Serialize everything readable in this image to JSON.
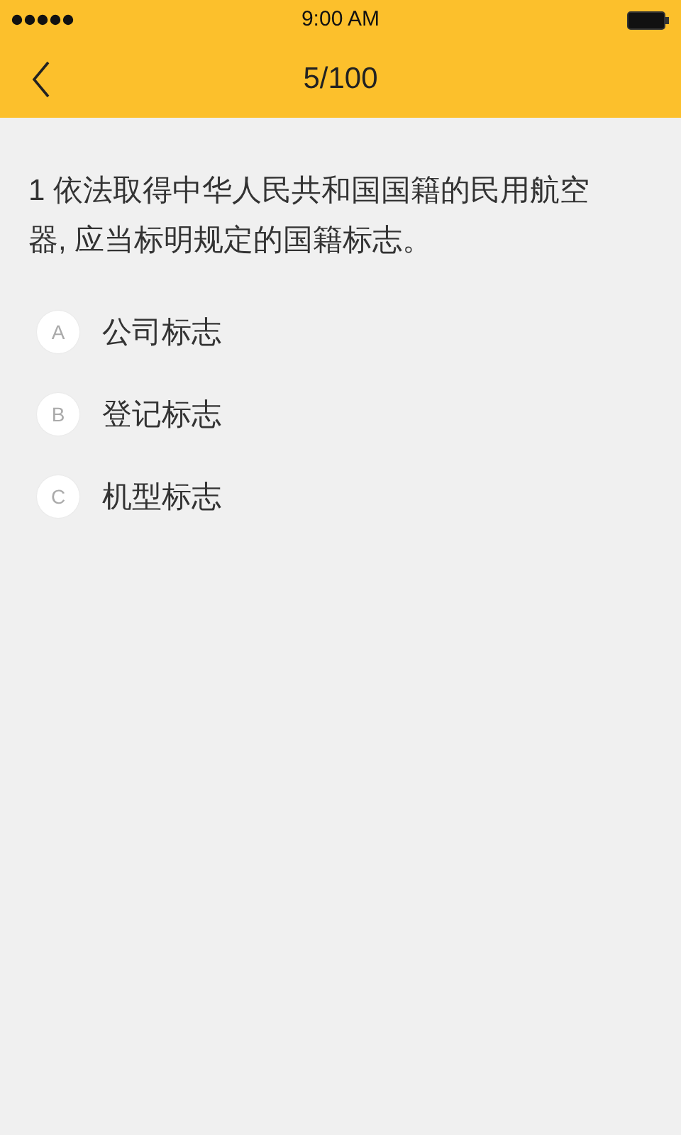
{
  "status_bar": {
    "time": "9:00 AM"
  },
  "nav_bar": {
    "title": "5/100"
  },
  "question": {
    "text": "1 依法取得中华人民共和国国籍的民用航空器, 应当标明规定的国籍标志。"
  },
  "options": [
    {
      "letter": "A",
      "text": "公司标志"
    },
    {
      "letter": "B",
      "text": "登记标志"
    },
    {
      "letter": "C",
      "text": "机型标志"
    }
  ]
}
